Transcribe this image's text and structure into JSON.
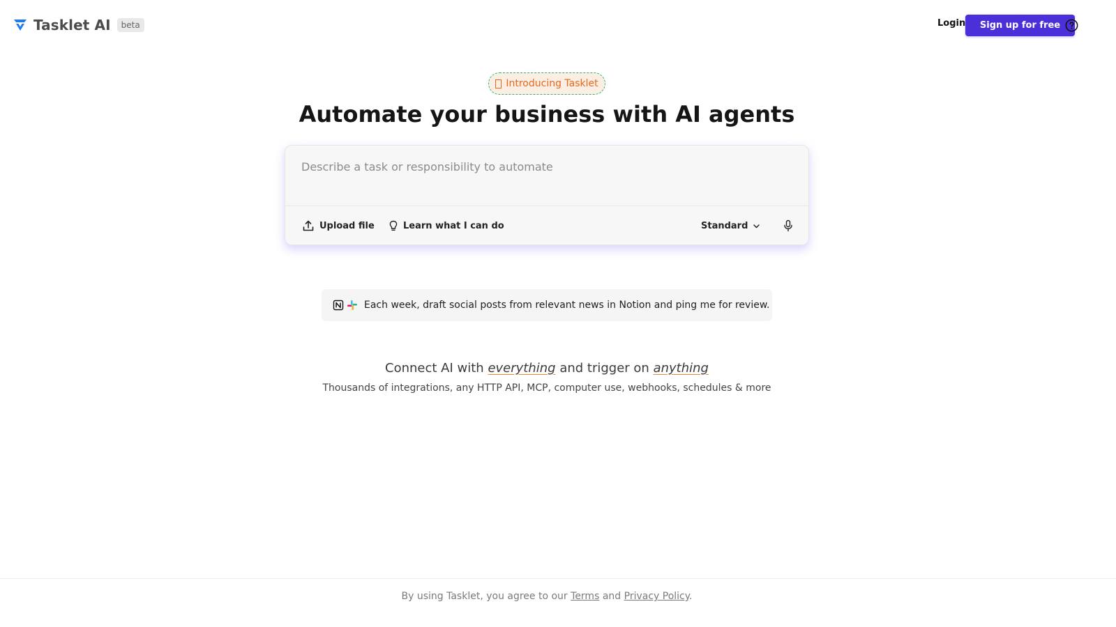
{
  "header": {
    "brand_name": "Tasklet AI",
    "beta_label": "beta",
    "login_label": "Login",
    "signup_label": "Sign up for free",
    "help_icon": "question-circle-icon",
    "accent_color": "#4b2fd8",
    "logo_color": "#1e7be8"
  },
  "hero": {
    "intro_label": "Introducing Tasklet",
    "headline": "Automate your business with AI agents"
  },
  "prompt": {
    "placeholder": "Describe a task or responsibility to automate",
    "value": "",
    "upload_label": "Upload file",
    "learn_label": "Learn what I can do",
    "mode_value": "Standard",
    "icons": [
      "upload-icon",
      "lightbulb-icon",
      "chevron-down-icon",
      "microphone-icon"
    ]
  },
  "example": {
    "text": "Each week, draft social posts from relevant news in Notion and ping me for review.",
    "app_icons": [
      "notion-icon",
      "slack-icon"
    ]
  },
  "connect": {
    "prefix": "Connect AI with",
    "word1": "everything",
    "middle": "and trigger on",
    "word2": "anything",
    "subtitle": "Thousands of integrations, any HTTP API, MCP, computer use, webhooks, schedules & more"
  },
  "footer": {
    "prefix": "By using Tasklet, you agree to our",
    "terms_label": "Terms",
    "and_label": "and",
    "privacy_label": "Privacy Policy",
    "suffix": "."
  }
}
